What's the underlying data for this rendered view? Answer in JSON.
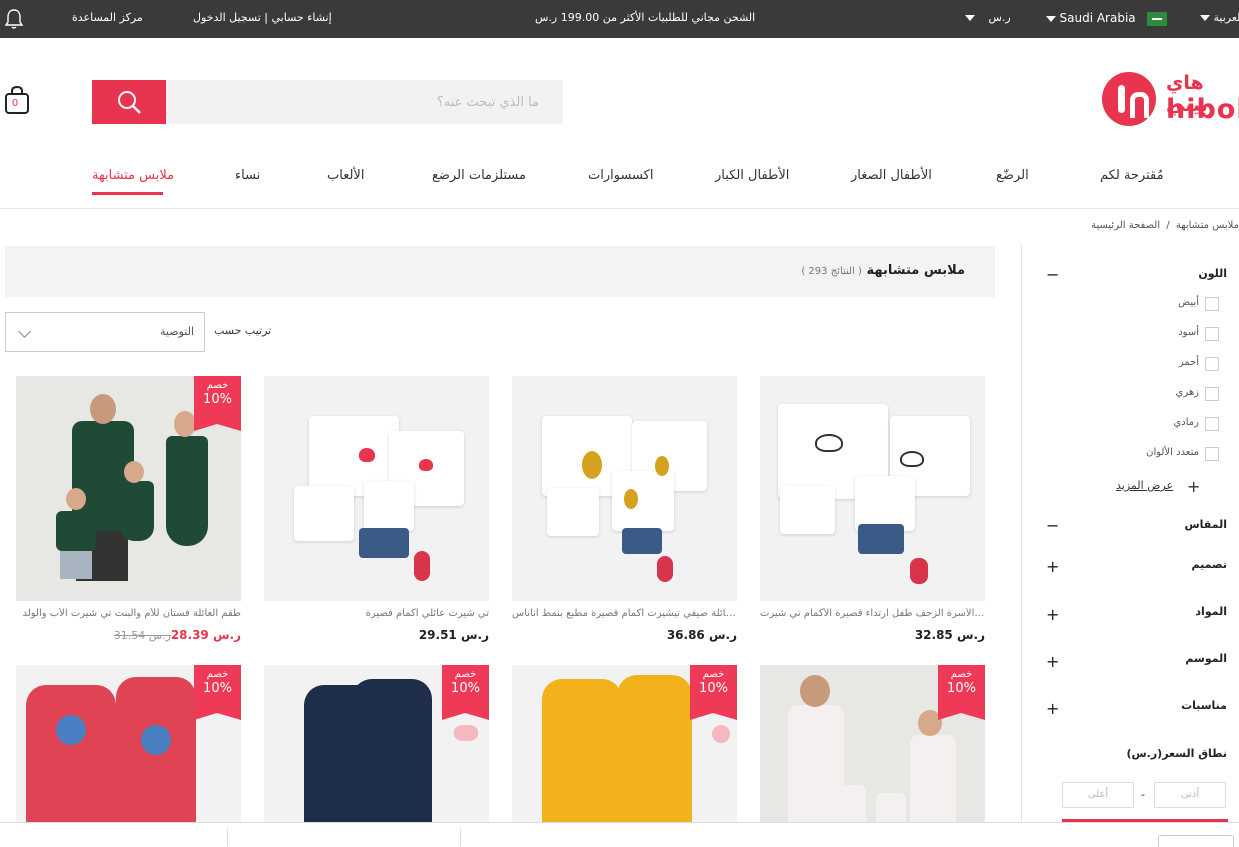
{
  "topbar": {
    "language": "العربية",
    "country": "Saudi Arabia",
    "currency": "ر.س",
    "shipping": "الشحن مجاني للطلبيات الأكثر من 199.00 ر.س",
    "login": "تسجيل الدخول",
    "sep": "|",
    "register": "إنشاء حسابي",
    "help": "مركز المساعدة"
  },
  "logo": {
    "ar": "هاي بيبي",
    "en": "hibob"
  },
  "search": {
    "placeholder": "ما الذي تبحث عنه؟"
  },
  "cart": {
    "count": "0"
  },
  "nav": [
    "مُقترحة لكم",
    "الرضّع",
    "الأطفال الصغار",
    "الأطفال الكبار",
    "اكسسوارات",
    "مستلزمات الرضع",
    "الألعاب",
    "نساء",
    "ملابس متشابهة"
  ],
  "breadcrumb": {
    "home": "الصفحة الرئيسية",
    "sep": "/",
    "current": "ملابس متشابهة"
  },
  "filters": {
    "color_title": "اللون",
    "colors": [
      "أبيض",
      "أسود",
      "أحمر",
      "زهري",
      "رمادي",
      "متعدد الألوان"
    ],
    "show_more": "عرض المزيد",
    "size": "المقاس",
    "design": "تصميم",
    "material": "المواد",
    "season": "الموسم",
    "occasion": "مناسبات",
    "price_range": "نطاق السعر(ر.س)",
    "min_placeholder": "أدنى",
    "max_placeholder": "أعلى",
    "dash": "-"
  },
  "listing": {
    "title": "ملابس متشابهة",
    "count": "( 293 النتائج )",
    "sort_label": "ترتيب حسب",
    "sort_value": "التوصية"
  },
  "badge": {
    "top": "خصم",
    "pct": "10%"
  },
  "products": [
    {
      "name": "ارتداء الأسرة الزحف طفل ارتداء قصيرة الأكمام تي شيرت",
      "price": "32.85 ر.س"
    },
    {
      "name": "طقم العائلة صيفي تيشيرت أكمام قصيرة مطبع بنمط أناناس",
      "price": "36.86 ر.س"
    },
    {
      "name": "تي شيرت عائلي أكمام قصيرة",
      "price": "29.51 ر.س"
    },
    {
      "name": "طقم العائلة فستان للأم والبنت تي شيرت الأب والولد",
      "price": "28.39 ر.س",
      "old": "31.54 ر.س"
    }
  ]
}
